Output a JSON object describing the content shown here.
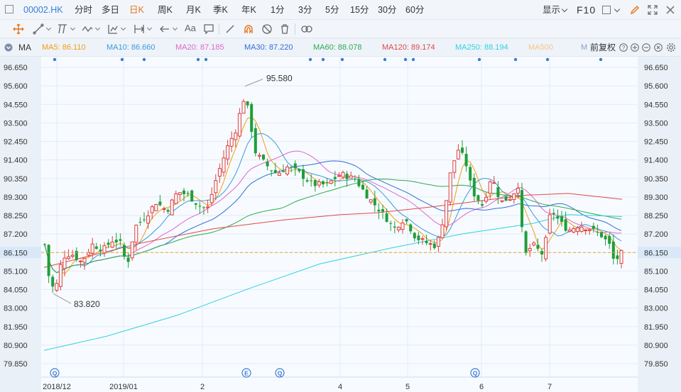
{
  "topbar": {
    "symbol": "00002.HK",
    "periods": [
      "分时",
      "多日",
      "日K",
      "周K",
      "月K",
      "季K",
      "年K",
      "1分",
      "3分",
      "5分",
      "15分",
      "30分",
      "60分"
    ],
    "active_period": "日K",
    "display_label": "显示",
    "f10_label": "F10"
  },
  "toolbar": {
    "text_tool_label": "Aa"
  },
  "mabar": {
    "label": "MA",
    "items": [
      {
        "text": "MA5: 86.110",
        "color": "#f39c12"
      },
      {
        "text": "MA10: 86.660",
        "color": "#3a9ad9"
      },
      {
        "text": "MA20: 87.185",
        "color": "#e066c9"
      },
      {
        "text": "MA30: 87.220",
        "color": "#2f6fd6"
      },
      {
        "text": "MA60: 88.078",
        "color": "#2eaa4f"
      },
      {
        "text": "MA120: 89.174",
        "color": "#e04848"
      },
      {
        "text": "MA250: 88.194",
        "color": "#32d0e0"
      },
      {
        "text": "MA500",
        "color": "#f5c58a"
      },
      {
        "text": "M",
        "color": "#8aa0c8"
      }
    ],
    "adjust_label": "前复权"
  },
  "chart_data": {
    "type": "candlestick",
    "y_ticks": [
      "96.650",
      "95.600",
      "94.550",
      "93.500",
      "92.450",
      "91.400",
      "90.350",
      "89.300",
      "88.250",
      "87.200",
      "86.150",
      "85.100",
      "84.050",
      "83.000",
      "81.950",
      "80.900",
      "79.850"
    ],
    "ylim": [
      79.85,
      96.65
    ],
    "x_labels": [
      "2018/12",
      "2019/01",
      "2",
      "4",
      "5",
      "6",
      "7"
    ],
    "current_price": "86.150",
    "current_value": 86.15,
    "high_label": "95.580",
    "high_value": 95.58,
    "low_label": "83.820",
    "low_value": 83.82,
    "event_markers": [
      "Q",
      "E",
      "Q",
      "Q"
    ],
    "up_color": "#e03c3c",
    "down_color": "#1f9e3a"
  }
}
